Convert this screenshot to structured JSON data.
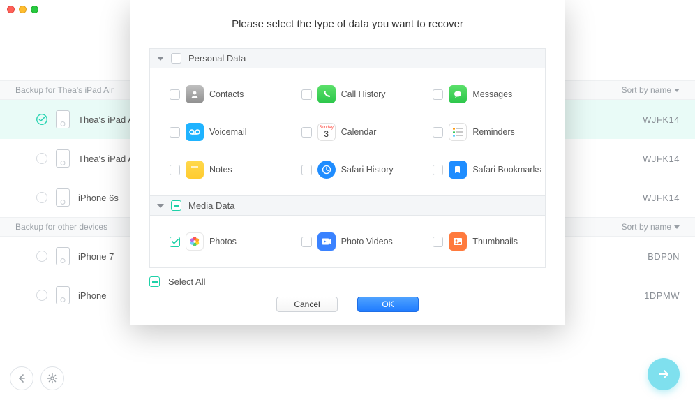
{
  "window": {
    "title": ""
  },
  "sections": [
    {
      "label": "Backup for Thea's iPad Air",
      "sort": "Sort by name"
    },
    {
      "label": "Backup for other devices",
      "sort": "Sort by name"
    }
  ],
  "devices": [
    {
      "name": "Thea's iPad A",
      "serial": "WJFK14",
      "selected": true
    },
    {
      "name": "Thea's iPad A",
      "serial": "WJFK14",
      "selected": false
    },
    {
      "name": "iPhone 6s",
      "serial": "WJFK14",
      "selected": false
    },
    {
      "name": "iPhone 7",
      "serial": "BDP0N",
      "selected": false
    },
    {
      "name": "iPhone",
      "serial": "1DPMW",
      "selected": false
    }
  ],
  "modal": {
    "title": "Please select the type of data you want to recover",
    "categories": [
      {
        "name": "Personal Data",
        "checked": false,
        "items": [
          {
            "label": "Contacts",
            "icon": "contacts",
            "checked": false
          },
          {
            "label": "Call History",
            "icon": "call",
            "checked": false
          },
          {
            "label": "Messages",
            "icon": "msg",
            "checked": false
          },
          {
            "label": "Voicemail",
            "icon": "vm",
            "checked": false
          },
          {
            "label": "Calendar",
            "icon": "cal",
            "checked": false
          },
          {
            "label": "Reminders",
            "icon": "rem",
            "checked": false
          },
          {
            "label": "Notes",
            "icon": "notes",
            "checked": false
          },
          {
            "label": "Safari History",
            "icon": "safh",
            "checked": false
          },
          {
            "label": "Safari Bookmarks",
            "icon": "safb",
            "checked": false
          }
        ]
      },
      {
        "name": "Media Data",
        "checked": "indeterminate",
        "items": [
          {
            "label": "Photos",
            "icon": "photos",
            "checked": true
          },
          {
            "label": "Photo Videos",
            "icon": "pvid",
            "checked": false
          },
          {
            "label": "Thumbnails",
            "icon": "thumb",
            "checked": false
          }
        ]
      }
    ],
    "selectAll": "Select All",
    "selectAllState": "indeterminate",
    "cancel": "Cancel",
    "ok": "OK"
  },
  "calendar": {
    "weekday": "Sunday",
    "day": "3"
  }
}
